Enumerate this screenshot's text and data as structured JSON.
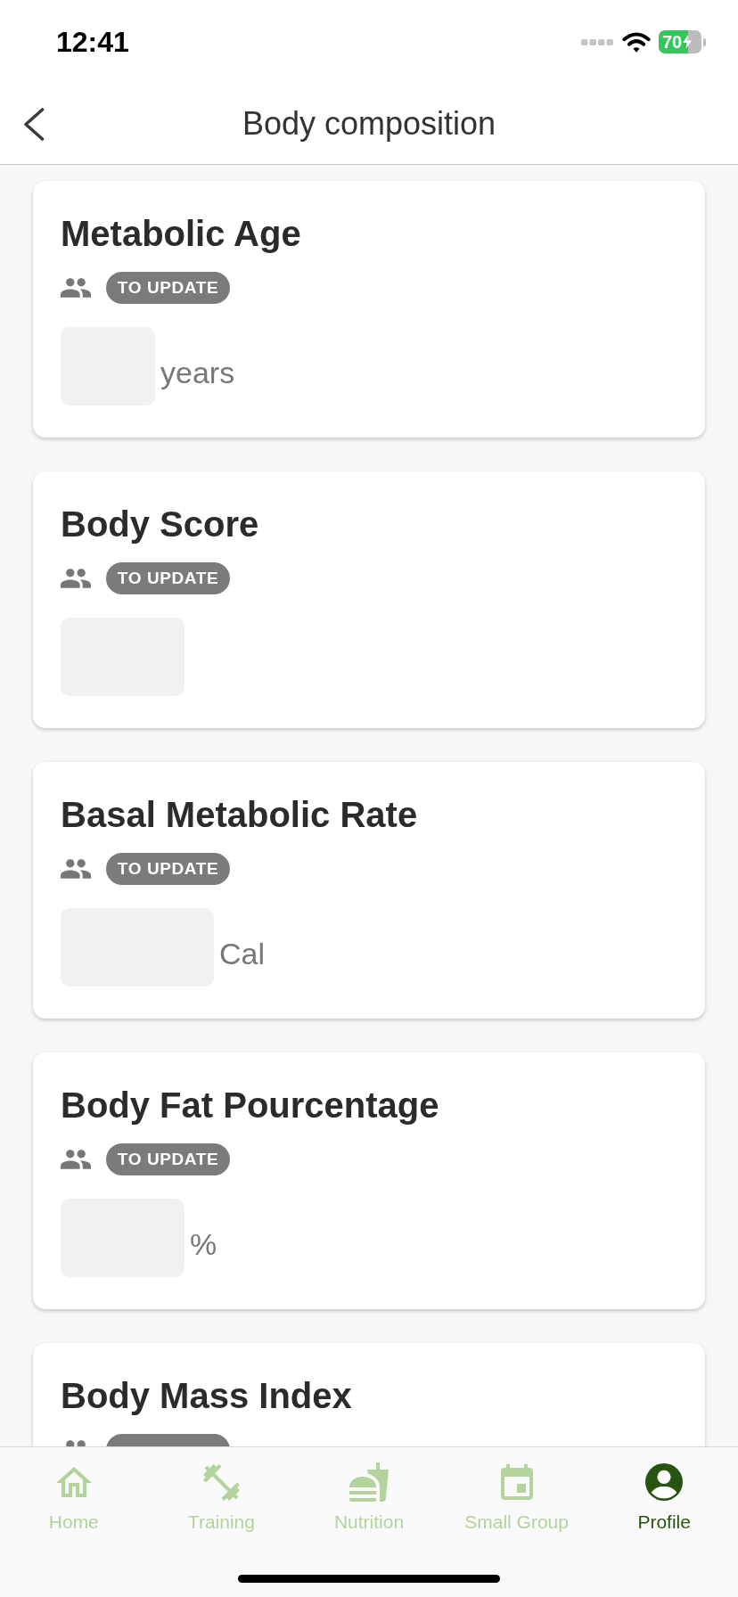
{
  "status_bar": {
    "time": "12:41",
    "battery": "70"
  },
  "header": {
    "title": "Body composition"
  },
  "cards": [
    {
      "title": "Metabolic Age",
      "status": "TO UPDATE",
      "unit": "years"
    },
    {
      "title": "Body Score",
      "status": "TO UPDATE"
    },
    {
      "title": "Basal Metabolic Rate",
      "status": "TO UPDATE",
      "unit": "Cal"
    },
    {
      "title": "Body Fat Pourcentage",
      "status": "TO UPDATE",
      "unit": "%"
    },
    {
      "title": "Body Mass Index"
    }
  ],
  "tabs": [
    {
      "label": "Home",
      "selected": false
    },
    {
      "label": "Training",
      "selected": false
    },
    {
      "label": "Nutrition",
      "selected": false
    },
    {
      "label": "Small Group",
      "selected": false
    },
    {
      "label": "Profile",
      "selected": true
    }
  ]
}
